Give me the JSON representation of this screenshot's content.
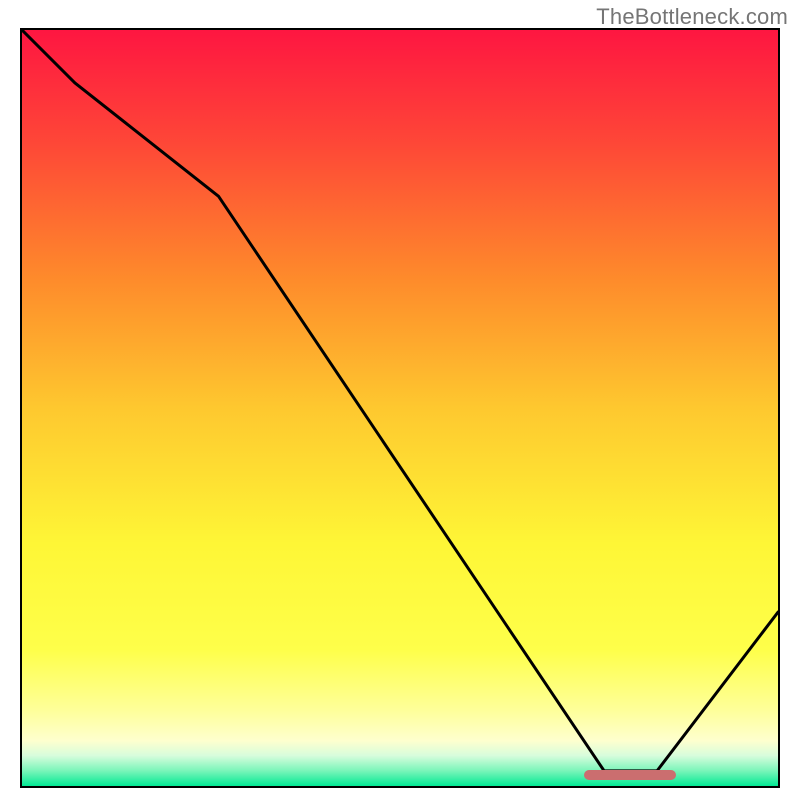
{
  "attribution": "TheBottleneck.com",
  "colors": {
    "top": "#fe1641",
    "mid_upper": "#fe9f27",
    "mid_lower": "#feff3f",
    "pale": "#feffb6",
    "bottom": "#02e994",
    "curve": "#000000",
    "marker": "#cb6e6f",
    "border": "#000000"
  },
  "chart_data": {
    "type": "line",
    "title": "",
    "xlabel": "",
    "ylabel": "",
    "xlim": [
      0,
      100
    ],
    "ylim": [
      0,
      100
    ],
    "grid": false,
    "legend": false,
    "series": [
      {
        "name": "curve",
        "x": [
          0,
          7,
          26,
          77,
          84,
          100
        ],
        "values": [
          100,
          93,
          78,
          2,
          2,
          23
        ]
      }
    ],
    "marker": {
      "x_start": 74,
      "x_end": 86,
      "y": 2,
      "height_pct": 1.3
    }
  }
}
